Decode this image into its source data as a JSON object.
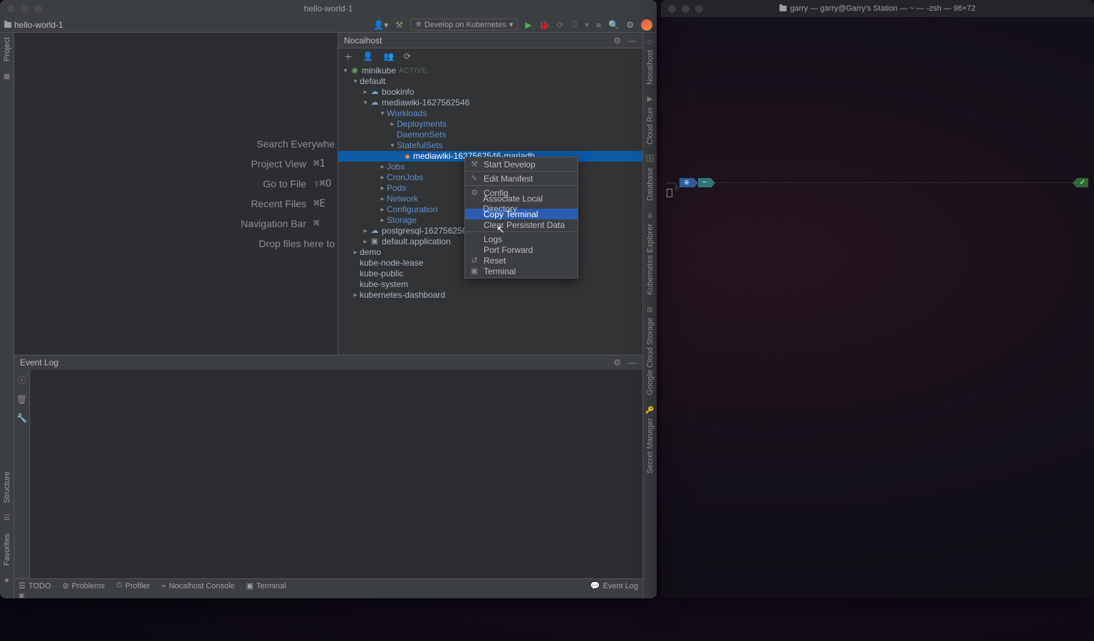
{
  "ide": {
    "title": "hello-world-1",
    "project_label": "hello-world-1",
    "develop_button": "Develop on Kubernetes",
    "placeholder": {
      "l1": "Search Everywhe",
      "l2": "Project View",
      "s2": "⌘1",
      "l3": "Go to File",
      "s3": "⇧⌘O",
      "l4": "Recent Files",
      "s4": "⌘E",
      "l5": "Navigation Bar",
      "s5": "⌘",
      "l6": "Drop files here to"
    },
    "nocalhost": {
      "title": "Nocalhost",
      "cluster": {
        "name": "minikube",
        "badge": "ACTIVE"
      },
      "ns_default": "default",
      "bookinfo": "bookinfo",
      "mediawiki": "mediawiki-1627562546",
      "workloads": "Workloads",
      "deployments": "Deployments",
      "daemonsets": "DaemonSets",
      "statefulsets": "StatefulSets",
      "selected_sts": "mediawiki-1627562546-mariadb",
      "jobs": "Jobs",
      "cronjobs": "CronJobs",
      "pods": "Pods",
      "network": "Network",
      "configuration": "Configuration",
      "storage": "Storage",
      "postgres": "postgresql-1627562567",
      "defaultapp": "default.application",
      "demo": "demo",
      "kube_node_lease": "kube-node-lease",
      "kube_public": "kube-public",
      "kube_system": "kube-system",
      "k8s_dashboard": "kubernetes-dashboard"
    },
    "event_log": {
      "title": "Event Log"
    },
    "statusbar": {
      "todo": "TODO",
      "problems": "Problems",
      "profiler": "Profiler",
      "nocalhost_console": "Nocalhost Console",
      "terminal": "Terminal",
      "event_log": "Event Log"
    },
    "left_gutter": {
      "project": "Project"
    },
    "right_gutter": {
      "nocalhost": "Nocalhost",
      "cloud_run": "Cloud Run",
      "database": "Database",
      "k8s_explorer": "Kubernetes Explorer",
      "gcs": "Google Cloud Storage",
      "secret_manager": "Secret Manager"
    },
    "left_gutter_lower": {
      "structure": "Structure",
      "favorites": "Favorites"
    }
  },
  "context_menu": {
    "start_develop": "Start Develop",
    "edit_manifest": "Edit Manifest",
    "config": "Config",
    "associate": "Associate Local Directory",
    "copy_terminal": "Copy Terminal",
    "clear_persistent": "Clear Persistent Data",
    "logs": "Logs",
    "port_forward": "Port Forward",
    "reset": "Reset",
    "terminal": "Terminal"
  },
  "terminal": {
    "title": "garry — garry@Garry's Station — ~ — -zsh — 96×72",
    "seg_home": "~",
    "seg_ok": "✓"
  }
}
